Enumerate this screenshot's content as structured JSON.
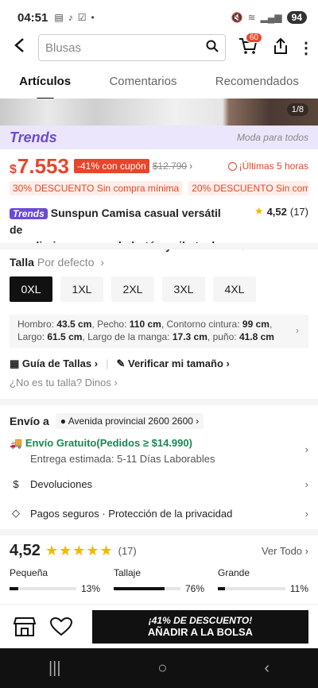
{
  "status": {
    "time": "04:51",
    "battery": "94"
  },
  "search": {
    "placeholder": "Blusas",
    "cart_count": "60"
  },
  "tabs": [
    {
      "label": "Artículos"
    },
    {
      "label": "Comentarios"
    },
    {
      "label": "Recomendados"
    }
  ],
  "gallery": {
    "counter": "1/8"
  },
  "trends": {
    "logo": "Trends",
    "tagline": "Moda para todos"
  },
  "price": {
    "currency": "$",
    "value": "7.553",
    "discount": "-41% con cupón",
    "old": "$12.790",
    "urgency": "¡Últimas 5 horas"
  },
  "coupons": [
    "30% DESCUENTO Sin compra mínima",
    "20% DESCUENTO Sin compr..."
  ],
  "product": {
    "tag": "Trends",
    "title_line1": "Sunspun Camisa casual versátil de",
    "title_line2": "uso diario con un solo botón y ribete de",
    "rating": "4,52",
    "reviews": "(17)"
  },
  "size_section": {
    "label": "Talla",
    "default": "Por defecto",
    "sizes": [
      "0XL",
      "1XL",
      "2XL",
      "3XL",
      "4XL"
    ],
    "selected": "0XL"
  },
  "measurements": {
    "hombro_label": "Hombro:",
    "hombro": "43.5 cm",
    "pecho_label": "Pecho:",
    "pecho": "110 cm",
    "cintura_label": "Contorno cintura:",
    "cintura": "99 cm",
    "largo_label": "Largo:",
    "largo": "61.5 cm",
    "manga_label": "Largo de la manga:",
    "manga": "17.3 cm",
    "puno_label": "puño:",
    "puno": "41.8 cm"
  },
  "guide": {
    "guia": "Guía de Tallas",
    "verificar": "Verificar mi tamaño",
    "no_es": "¿No es tu talla? Dinos"
  },
  "shipping": {
    "label": "Envío a",
    "address": "Avenida provincial 2600 2600",
    "free": "Envío Gratuito(Pedidos ≥ $14.990)",
    "estimate": "Entrega estimada: 5-11 Días Laborables",
    "returns": "Devoluciones",
    "secure": "Pagos seguros · Protección de la privacidad"
  },
  "reviews": {
    "score": "4,52",
    "count": "(17)",
    "view_all": "Ver Todo",
    "fit": [
      {
        "label": "Pequeña",
        "pct": "13%",
        "value": 0.13
      },
      {
        "label": "Tallaje",
        "pct": "76%",
        "value": 0.76
      },
      {
        "label": "Grande",
        "pct": "11%",
        "value": 0.11
      }
    ]
  },
  "cta": {
    "discount": "¡41% DE DESCUENTO!",
    "add": "AÑADIR A LA BOLSA"
  }
}
